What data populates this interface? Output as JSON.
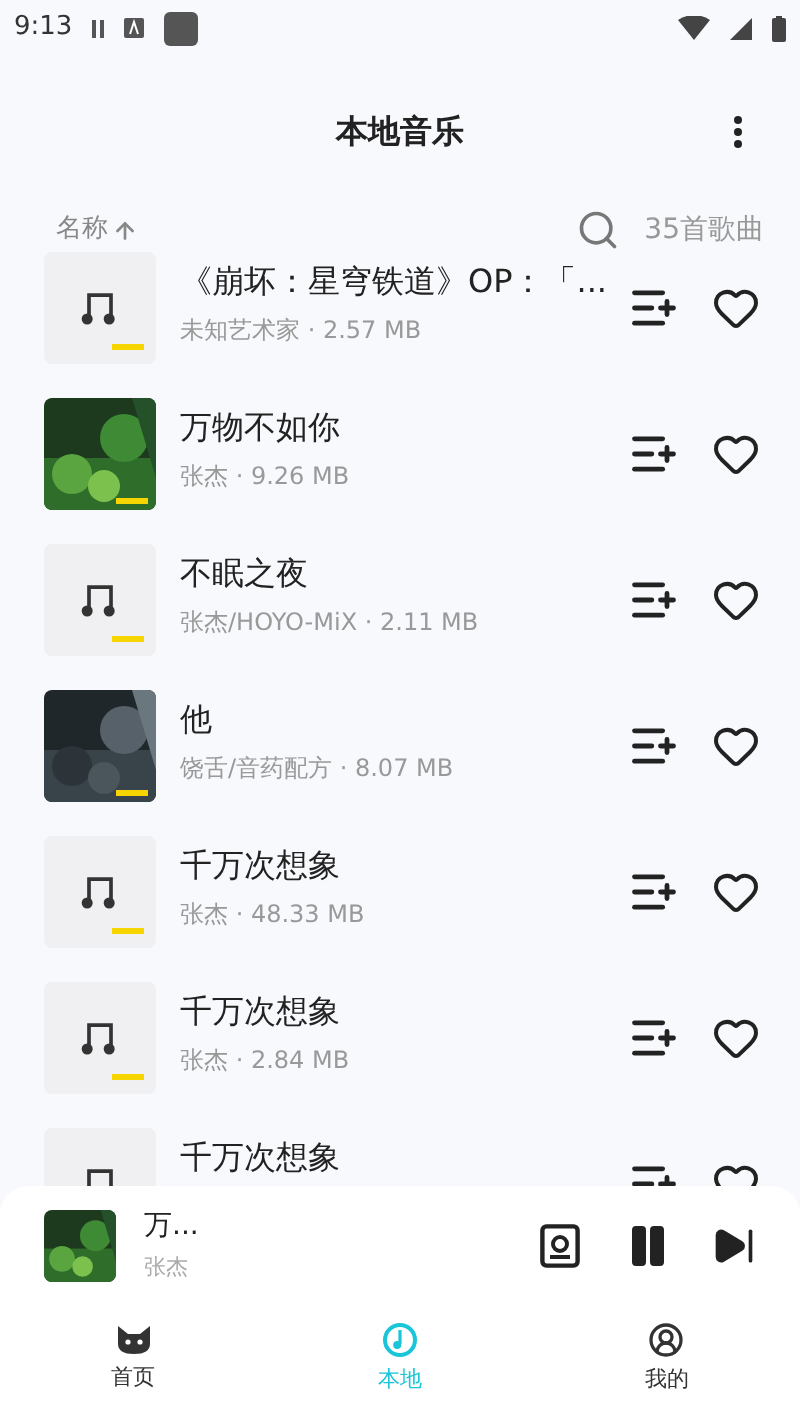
{
  "status_bar": {
    "time": "9:13"
  },
  "header": {
    "title": "本地音乐"
  },
  "sort": {
    "label": "名称",
    "count": "35首歌曲"
  },
  "songs": [
    {
      "title": "《崩坏：星穹铁道》OP：「...",
      "subtitle": "未知艺术家 · 2.57 MB",
      "kind": "placeholder"
    },
    {
      "title": "万物不如你",
      "subtitle": "张杰 · 9.26 MB",
      "kind": "forest"
    },
    {
      "title": "不眠之夜",
      "subtitle": "张杰/HOYO-MiX · 2.11 MB",
      "kind": "placeholder"
    },
    {
      "title": "他",
      "subtitle": "饶舌/音药配方 · 8.07 MB",
      "kind": "dark"
    },
    {
      "title": "千万次想象",
      "subtitle": "张杰 · 48.33 MB",
      "kind": "placeholder"
    },
    {
      "title": "千万次想象",
      "subtitle": "张杰 · 2.84 MB",
      "kind": "placeholder"
    },
    {
      "title": "千万次想象",
      "kind": "placeholder"
    }
  ],
  "player": {
    "title": "万...",
    "artist": "张杰",
    "kind": "forest",
    "playing": true
  },
  "nav": [
    {
      "label": "首页",
      "selected": false
    },
    {
      "label": "本地",
      "selected": true
    },
    {
      "label": "我的",
      "selected": false
    }
  ]
}
